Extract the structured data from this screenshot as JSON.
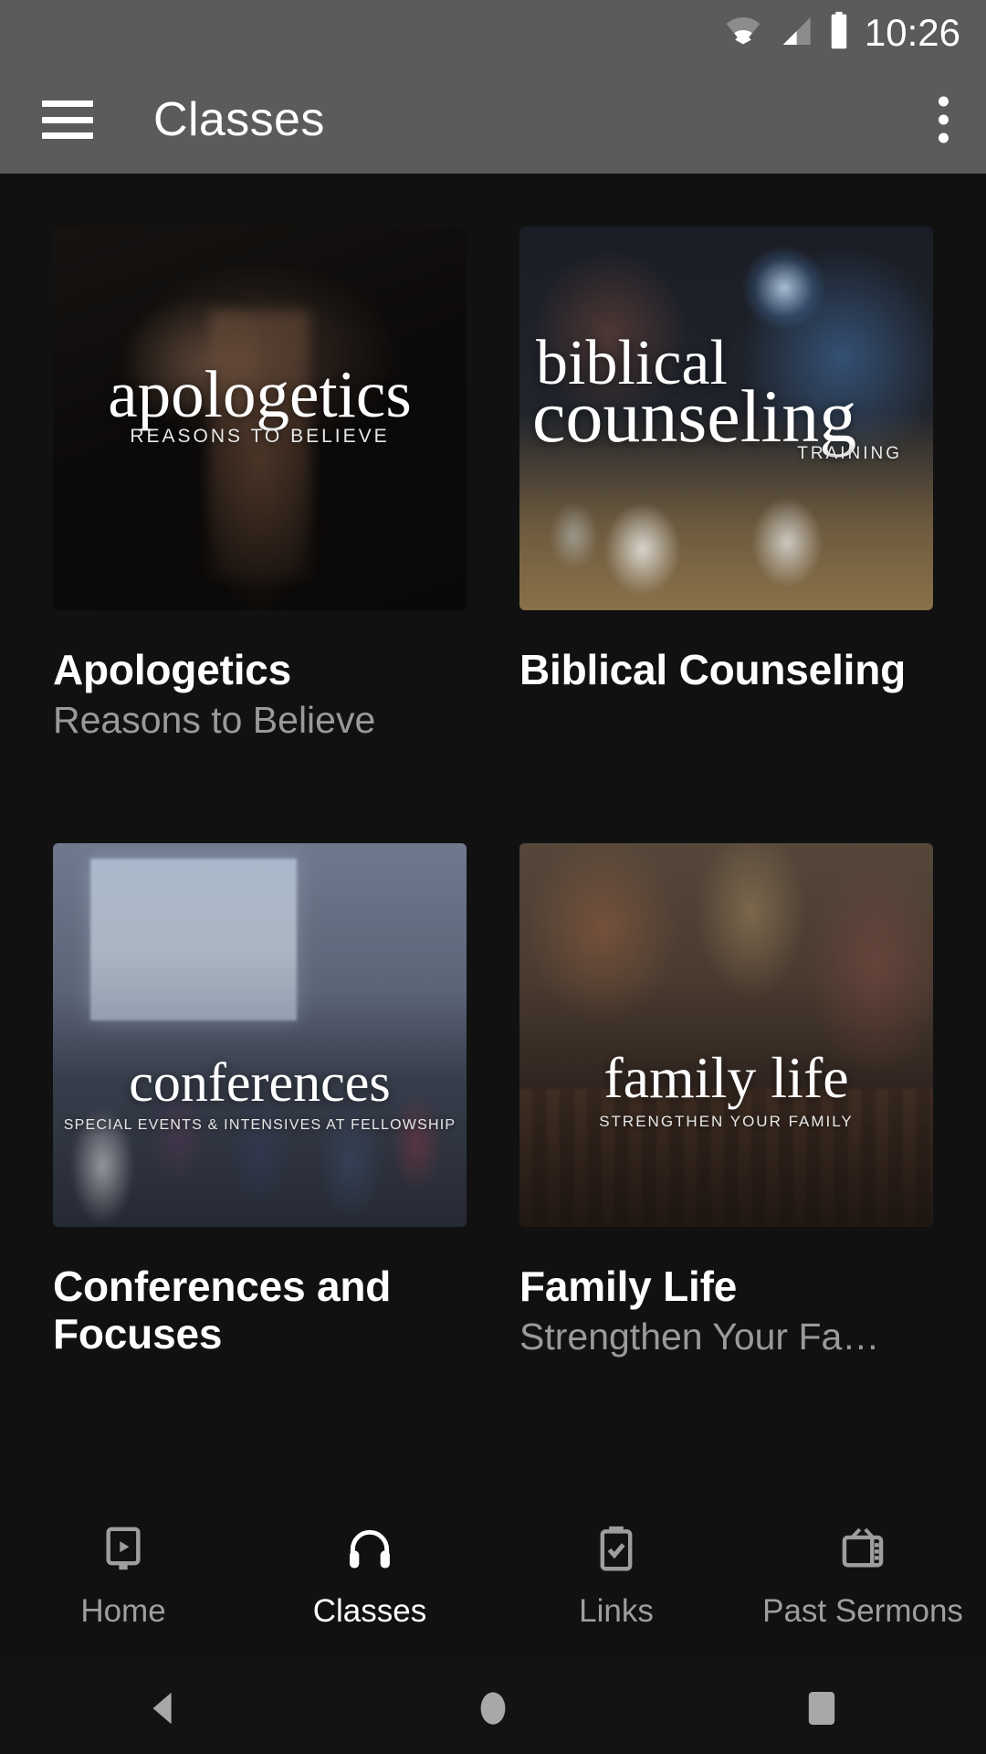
{
  "status_bar": {
    "time": "10:26",
    "icons": [
      "wifi-icon",
      "cellular-signal-icon",
      "battery-icon"
    ]
  },
  "app_bar": {
    "menu_icon": "hamburger-menu-icon",
    "title": "Classes",
    "overflow_icon": "overflow-menu-icon"
  },
  "colors": {
    "app_bar_background": "#5b5b5b",
    "content_background": "#111111",
    "title_text": "#ffffff",
    "subtitle_text": "#9a9a9a",
    "nav_inactive": "#9e9e9e",
    "nav_active": "#ffffff"
  },
  "classes": [
    {
      "title": "Apologetics",
      "subtitle": "Reasons to Believe",
      "artwork_title": "apologetics",
      "artwork_subtitle": "REASONS TO BELIEVE"
    },
    {
      "title": "Biblical Counseling",
      "subtitle": "",
      "artwork_title_line1": "biblical",
      "artwork_title_line2": "counseling",
      "artwork_subtitle": "TRAINING"
    },
    {
      "title": "Conferences and Focuses",
      "subtitle": "",
      "artwork_title": "conferences",
      "artwork_subtitle": "SPECIAL EVENTS & INTENSIVES AT FELLOWSHIP"
    },
    {
      "title": "Family Life",
      "subtitle": "Strengthen Your Fa…",
      "artwork_title": "family life",
      "artwork_subtitle": "STRENGTHEN YOUR FAMILY"
    }
  ],
  "bottom_nav": {
    "items": [
      {
        "label": "Home",
        "icon": "monitor-play-icon",
        "active": false
      },
      {
        "label": "Classes",
        "icon": "headphones-icon",
        "active": true
      },
      {
        "label": "Links",
        "icon": "clipboard-check-icon",
        "active": false
      },
      {
        "label": "Past Sermons",
        "icon": "television-icon",
        "active": false
      }
    ]
  },
  "system_nav": {
    "back": "back-triangle-icon",
    "home": "home-circle-icon",
    "recents": "recents-square-icon"
  }
}
